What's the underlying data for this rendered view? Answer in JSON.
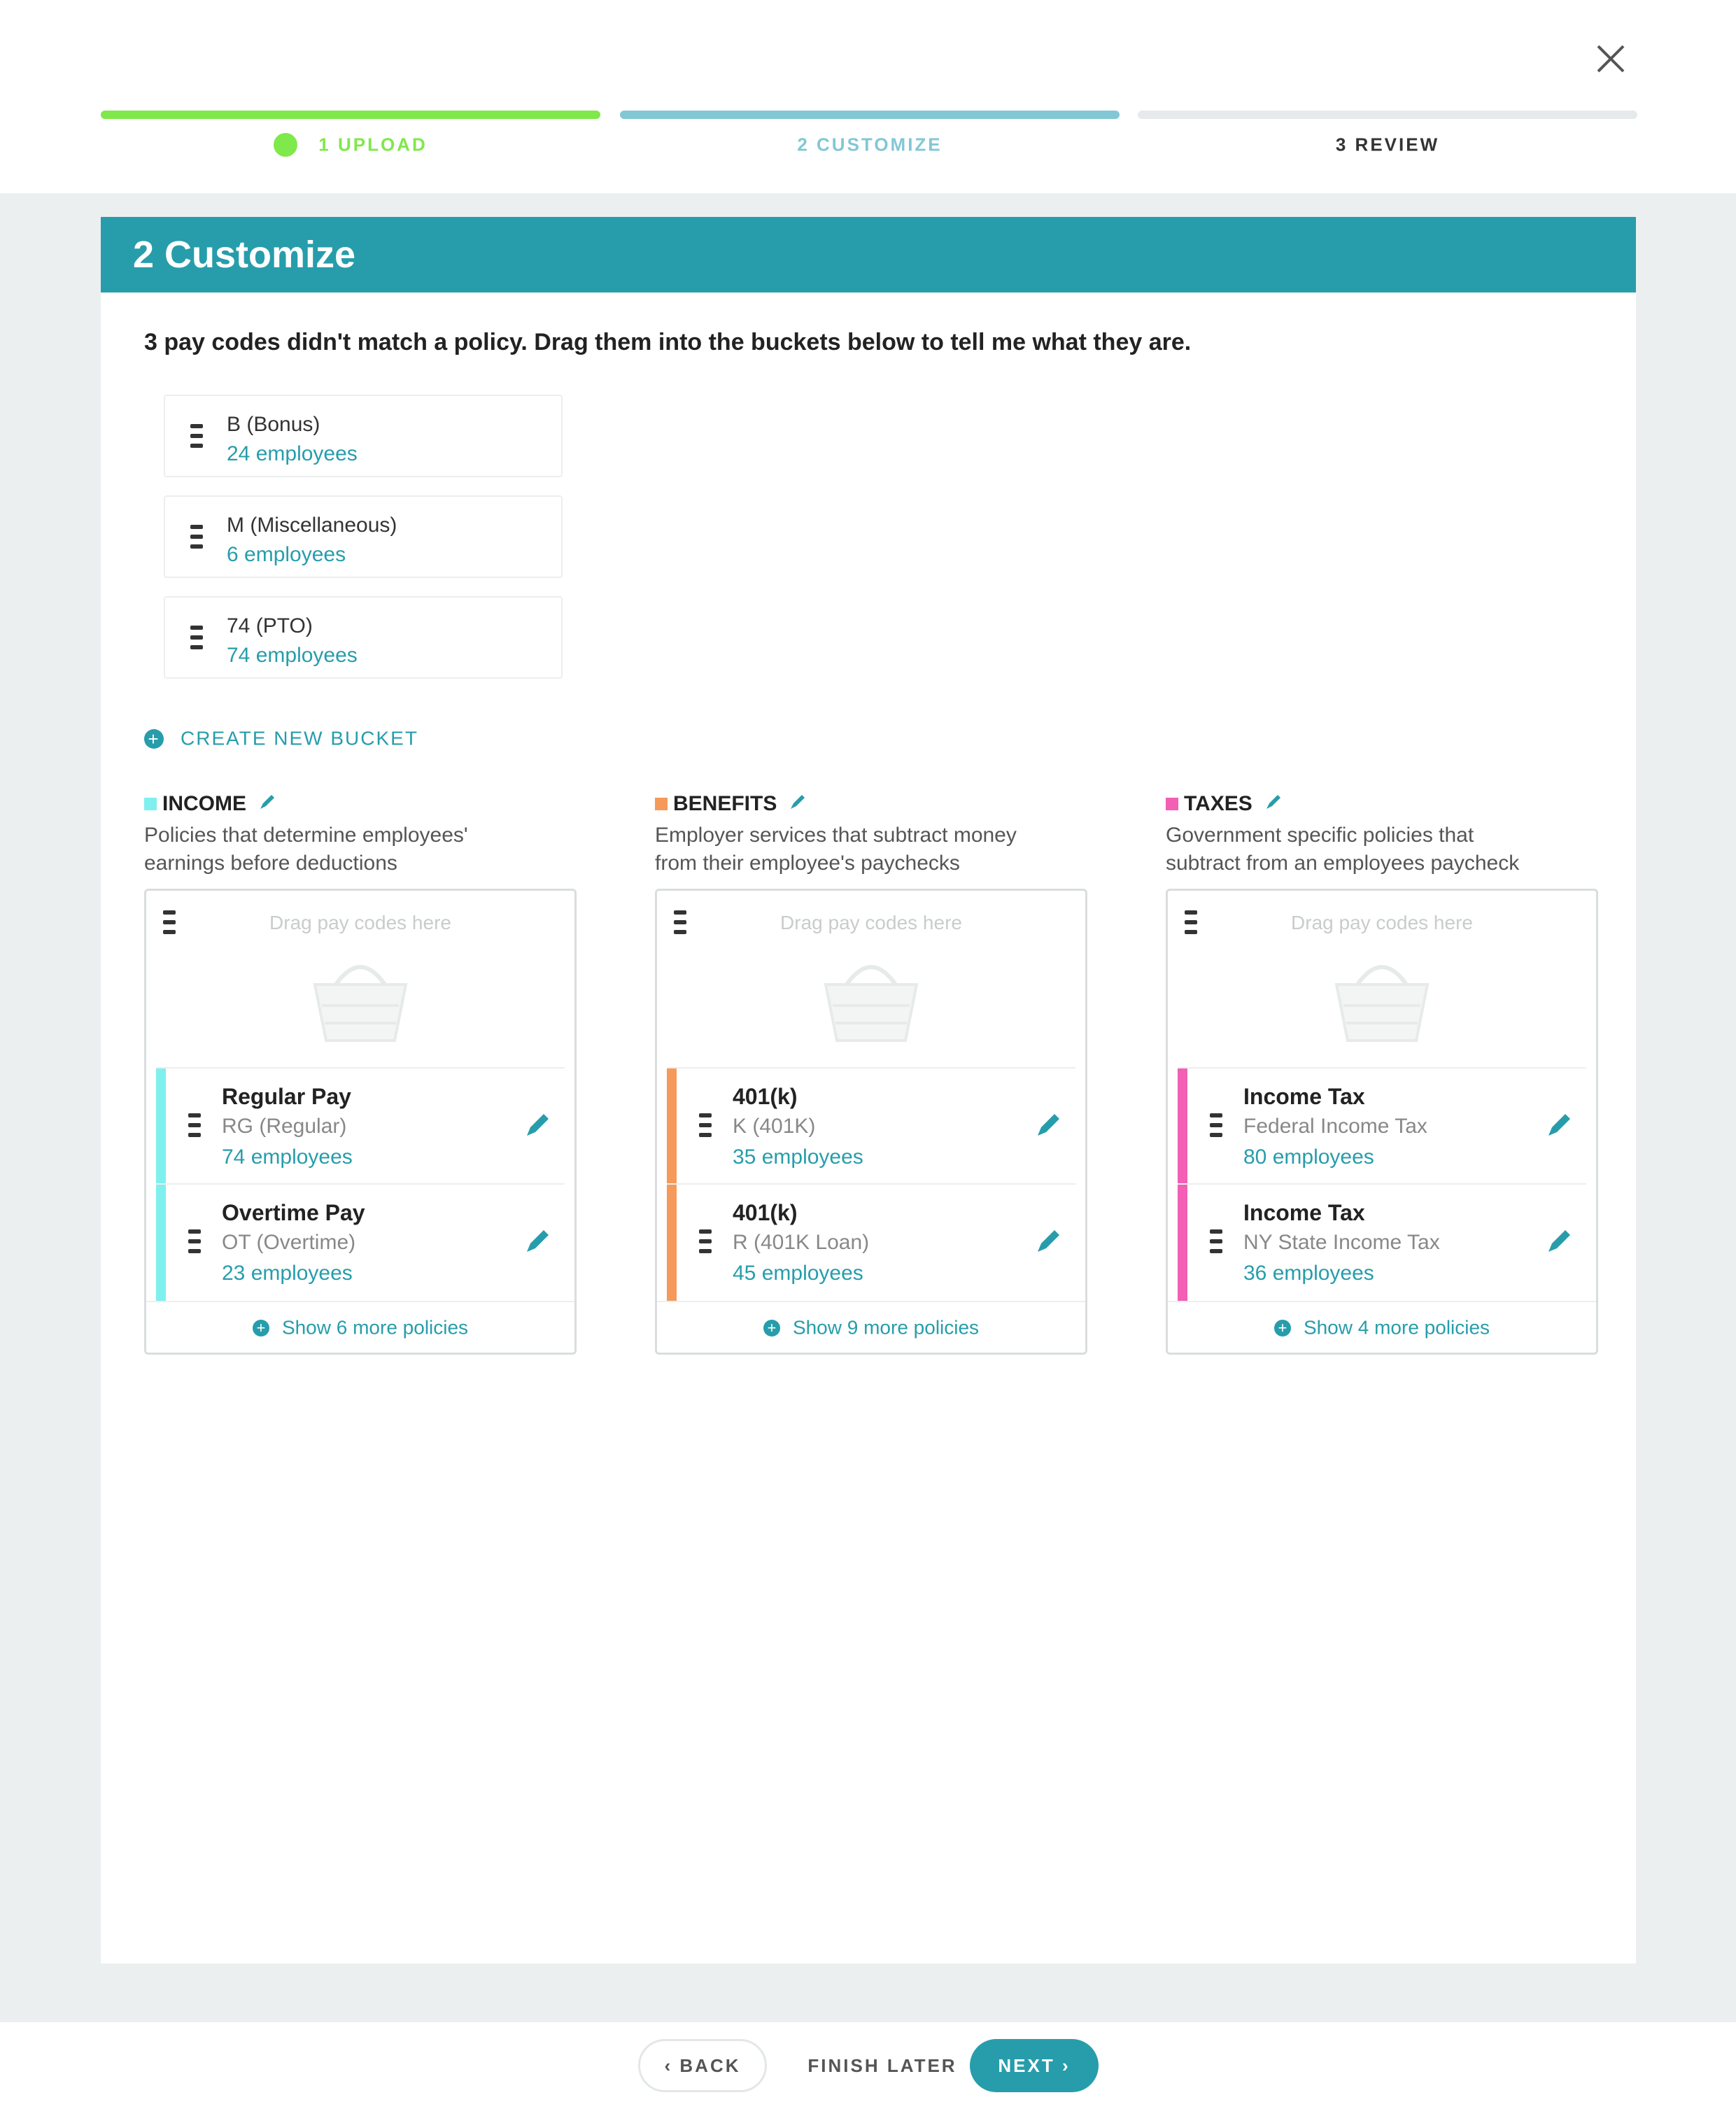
{
  "wizard": {
    "steps": [
      {
        "label": "1 Upload",
        "color": "#7fe84a"
      },
      {
        "label": "2 Customize",
        "color": "#82c7d4"
      },
      {
        "label": "3 Review",
        "color": "#e6eaea"
      }
    ]
  },
  "panel": {
    "title": "2 Customize",
    "instructions": "3 pay codes didn't match a policy. Drag them into the buckets below to tell me what they are."
  },
  "unmatched": [
    {
      "code": "B (Bonus)",
      "employees": "24 employees"
    },
    {
      "code": "M (Miscellaneous)",
      "employees": "6 employees"
    },
    {
      "code": "74 (PTO)",
      "employees": "74 employees"
    }
  ],
  "create_bucket_label": "Create new bucket",
  "drop_hint": "Drag pay codes here",
  "buckets": [
    {
      "name": "Income",
      "color": "#7ff0ee",
      "description_line1": "Policies that determine employees'",
      "description_line2": "earnings before deductions",
      "policies": [
        {
          "name": "Regular Pay",
          "code": "RG (Regular)",
          "employees": "74 employees"
        },
        {
          "name": "Overtime Pay",
          "code": "OT (Overtime)",
          "employees": "23 employees"
        }
      ],
      "show_more": "Show 6 more policies"
    },
    {
      "name": "Benefits",
      "color": "#f59a5a",
      "description_line1": "Employer services that subtract money",
      "description_line2": "from their employee's paychecks",
      "policies": [
        {
          "name": "401(k)",
          "code": "K (401K)",
          "employees": "35 employees"
        },
        {
          "name": "401(k)",
          "code": "R (401K Loan)",
          "employees": "45 employees"
        }
      ],
      "show_more": "Show 9 more policies"
    },
    {
      "name": "Taxes",
      "color": "#f25fb4",
      "description_line1": "Government specific policies that",
      "description_line2": "subtract from an employees paycheck",
      "policies": [
        {
          "name": "Income Tax",
          "code": "Federal Income Tax",
          "employees": "80 employees"
        },
        {
          "name": "Income Tax",
          "code": "NY State Income Tax",
          "employees": "36 employees"
        }
      ],
      "show_more": "Show 4 more policies"
    }
  ],
  "footer": {
    "back": "Back",
    "finish_later": "Finish later",
    "next": "Next"
  },
  "accent_color": "#279dab",
  "icons": {
    "close": "close-icon",
    "drag": "drag-handle-icon",
    "edit": "pencil-icon",
    "basket": "basket-icon",
    "add": "plus-icon"
  }
}
